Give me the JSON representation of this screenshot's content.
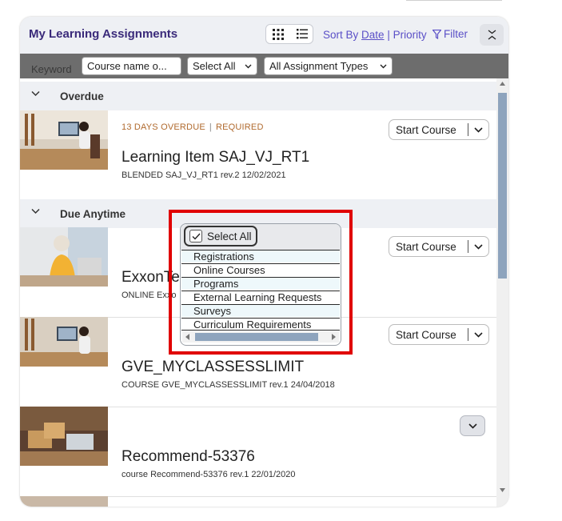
{
  "header": {
    "title": "My Learning Assignments",
    "sort_by_label": "Sort By",
    "sort_date": "Date",
    "sort_sep": "|",
    "sort_priority": "Priority",
    "filter_label": "Filter"
  },
  "filter_bar": {
    "keyword_label": "Keyword",
    "keyword_placeholder": "Course name o...",
    "status_select": "Select All",
    "type_select": "All Assignment Types"
  },
  "sections": [
    {
      "label": "Overdue"
    },
    {
      "label": "Due Anytime"
    }
  ],
  "items": [
    {
      "overdue": "13 DAYS OVERDUE",
      "sep": "|",
      "required": "REQUIRED",
      "title": "Learning Item SAJ_VJ_RT1",
      "subtitle": "BLENDED SAJ_VJ_RT1 rev.2 12/02/2021",
      "action": "Start Course"
    },
    {
      "title": "ExxonTe",
      "subtitle": "ONLINE Exxo",
      "action": "Start Course"
    },
    {
      "title": "GVE_MYCLASSESSLIMIT",
      "subtitle": "COURSE GVE_MYCLASSESSLIMIT rev.1 24/04/2018",
      "action": "Start Course"
    },
    {
      "title": "Recommend-53376",
      "subtitle": "course Recommend-53376 rev.1 22/01/2020"
    }
  ],
  "dropdown": {
    "select_all": "Select All",
    "options": [
      "Registrations",
      "Online Courses",
      "Programs",
      "External Learning Requests",
      "Surveys",
      "Curriculum Requirements"
    ]
  },
  "colors": {
    "accent": "#5a4fc7",
    "title": "#3a2a7a",
    "overdue": "#b06a2e",
    "highlight": "#e00000",
    "scroll_thumb": "#8ea4bd"
  }
}
